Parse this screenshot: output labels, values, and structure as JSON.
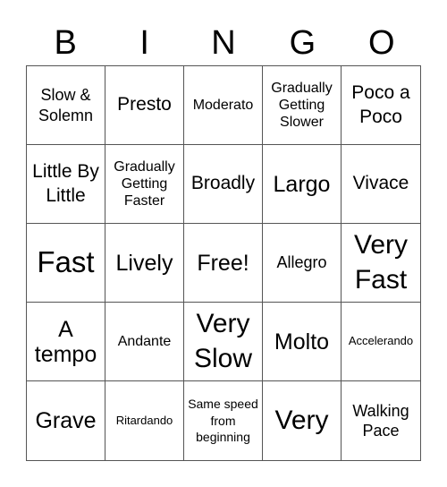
{
  "header": {
    "letters": [
      "B",
      "I",
      "N",
      "G",
      "O"
    ]
  },
  "board": {
    "rows": [
      [
        "Slow & Solemn",
        "Presto",
        "Moderato",
        "Gradually Getting Slower",
        "Poco a Poco"
      ],
      [
        "Little By Little",
        "Gradually Getting Faster",
        "Broadly",
        "Largo",
        "Vivace"
      ],
      [
        "Fast",
        "Lively",
        "Free!",
        "Allegro",
        "Very Fast"
      ],
      [
        "A tempo",
        "Andante",
        "Very Slow",
        "Molto",
        "Accelerando"
      ],
      [
        "Grave",
        "Ritardando",
        "Same speed from beginning",
        "Very",
        "Walking Pace"
      ]
    ],
    "free_space": "Free!"
  },
  "colors": {
    "text": "#000000",
    "grid_line": "#555555",
    "background": "#ffffff"
  }
}
